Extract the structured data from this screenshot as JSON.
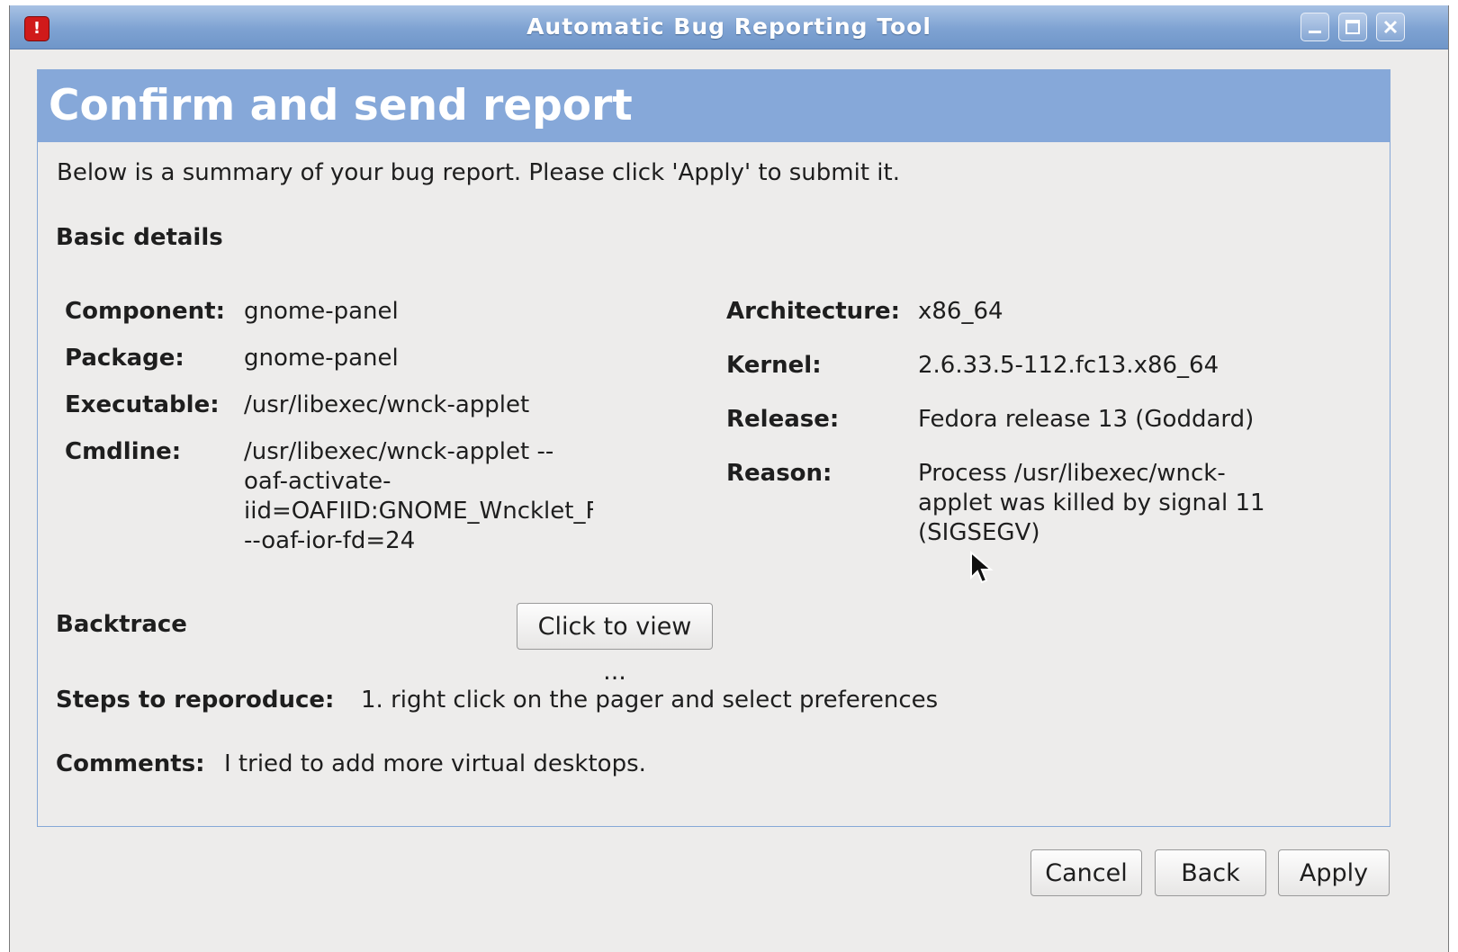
{
  "window": {
    "title": "Automatic Bug Reporting Tool",
    "icon": "bug-report-icon",
    "controls": [
      "minimize-icon",
      "maximize-icon",
      "close-icon"
    ]
  },
  "page": {
    "heading": "Confirm and send report",
    "intro": "Below is a summary of your bug report. Please click 'Apply' to submit it.",
    "basic_details_label": "Basic details"
  },
  "details": {
    "component_label": "Component:",
    "component": "gnome-panel",
    "package_label": "Package:",
    "package": "gnome-panel",
    "executable_label": "Executable:",
    "executable": "/usr/libexec/wnck-applet",
    "cmdline_label": "Cmdline:",
    "cmdline_lines": [
      "/usr/libexec/wnck-applet --",
      "oaf-activate-",
      "iid=OAFIID:GNOME_Wncklet_F",
      "--oaf-ior-fd=24"
    ],
    "architecture_label": "Architecture:",
    "architecture": "x86_64",
    "kernel_label": "Kernel:",
    "kernel": "2.6.33.5-112.fc13.x86_64",
    "release_label": "Release:",
    "release": "Fedora release 13 (Goddard)",
    "reason_label": "Reason:",
    "reason_lines": [
      "Process /usr/libexec/wnck-",
      "applet was killed by signal 11",
      "(SIGSEGV)"
    ]
  },
  "backtrace": {
    "label": "Backtrace",
    "button": "Click to view ..."
  },
  "steps": {
    "label": "Steps to reporoduce:",
    "value": "1. right click on the pager and select preferences"
  },
  "comments": {
    "label": "Comments:",
    "value": "I tried to add more virtual desktops."
  },
  "buttons": {
    "cancel": "Cancel",
    "back": "Back",
    "apply": "Apply"
  },
  "colors": {
    "titlebar": "#7ea2d2",
    "header_band": "#86a8d9",
    "window_bg": "#edeceb",
    "app_icon": "#d01a1a"
  }
}
